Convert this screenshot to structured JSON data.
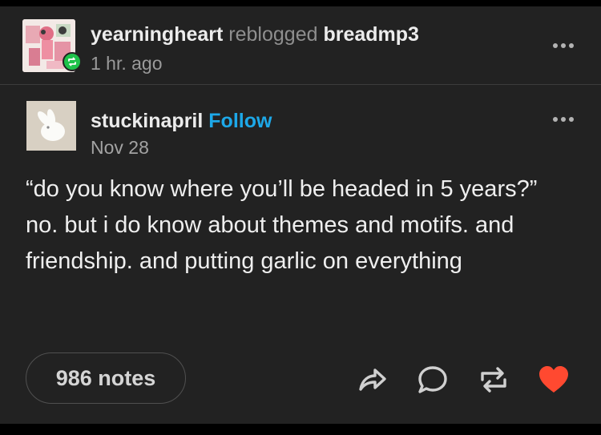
{
  "header": {
    "reblogger": "yearningheart",
    "action_text": "reblogged",
    "source": "breadmp3",
    "time": "1 hr. ago"
  },
  "post": {
    "author": "stuckinapril",
    "follow_label": "Follow",
    "date": "Nov 28",
    "body": "“do you know where you’ll be headed in 5 years?” no. but i do know about themes and motifs. and friendship. and putting garlic on everything"
  },
  "footer": {
    "notes_label": "986 notes",
    "actions": [
      "share-icon",
      "reply-icon",
      "reblog-icon",
      "like-icon"
    ]
  },
  "colors": {
    "card_bg": "#222222",
    "follow_blue": "#1da8e8",
    "reblog_green": "#1ec24a",
    "heart_red": "#ff4930"
  }
}
